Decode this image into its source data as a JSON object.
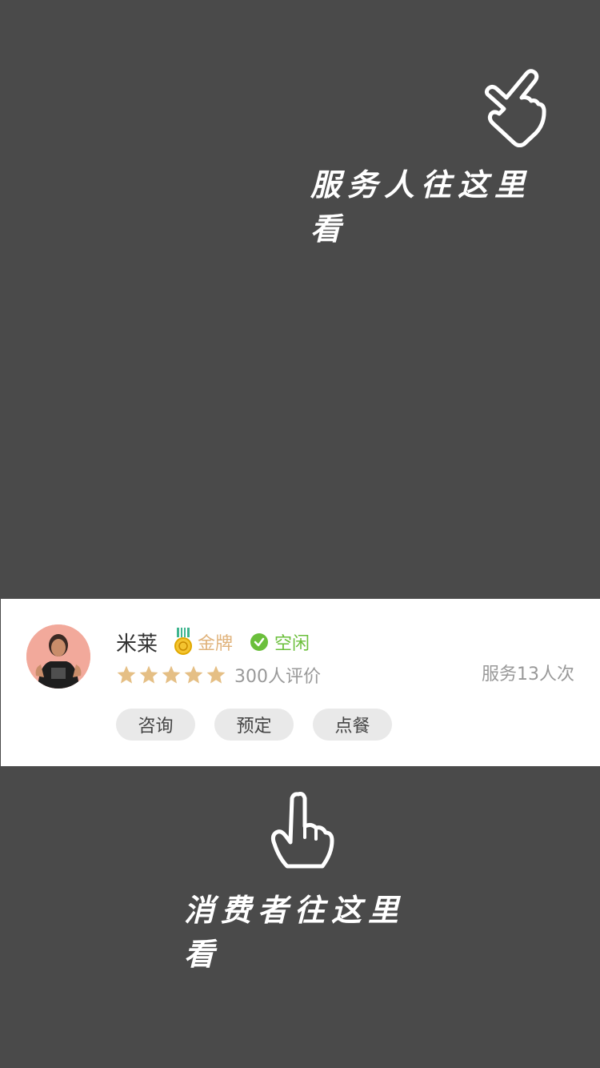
{
  "hints": {
    "top_text": "服务人往这里看",
    "bottom_text": "消费者往这里看"
  },
  "card": {
    "name": "米莱",
    "badge": "金牌",
    "status": "空闲",
    "rating": 5,
    "reviews": "300人评价",
    "served": "服务13人次",
    "actions": [
      "咨询",
      "预定",
      "点餐"
    ]
  },
  "colors": {
    "overlay": "#4a4a4a",
    "gold": "#e0b27a",
    "status_green": "#6bbf3b",
    "star": "#e5bf85"
  },
  "icons": [
    "hand-pointer-icon",
    "medal-icon",
    "check-circle-icon",
    "star-icon"
  ]
}
